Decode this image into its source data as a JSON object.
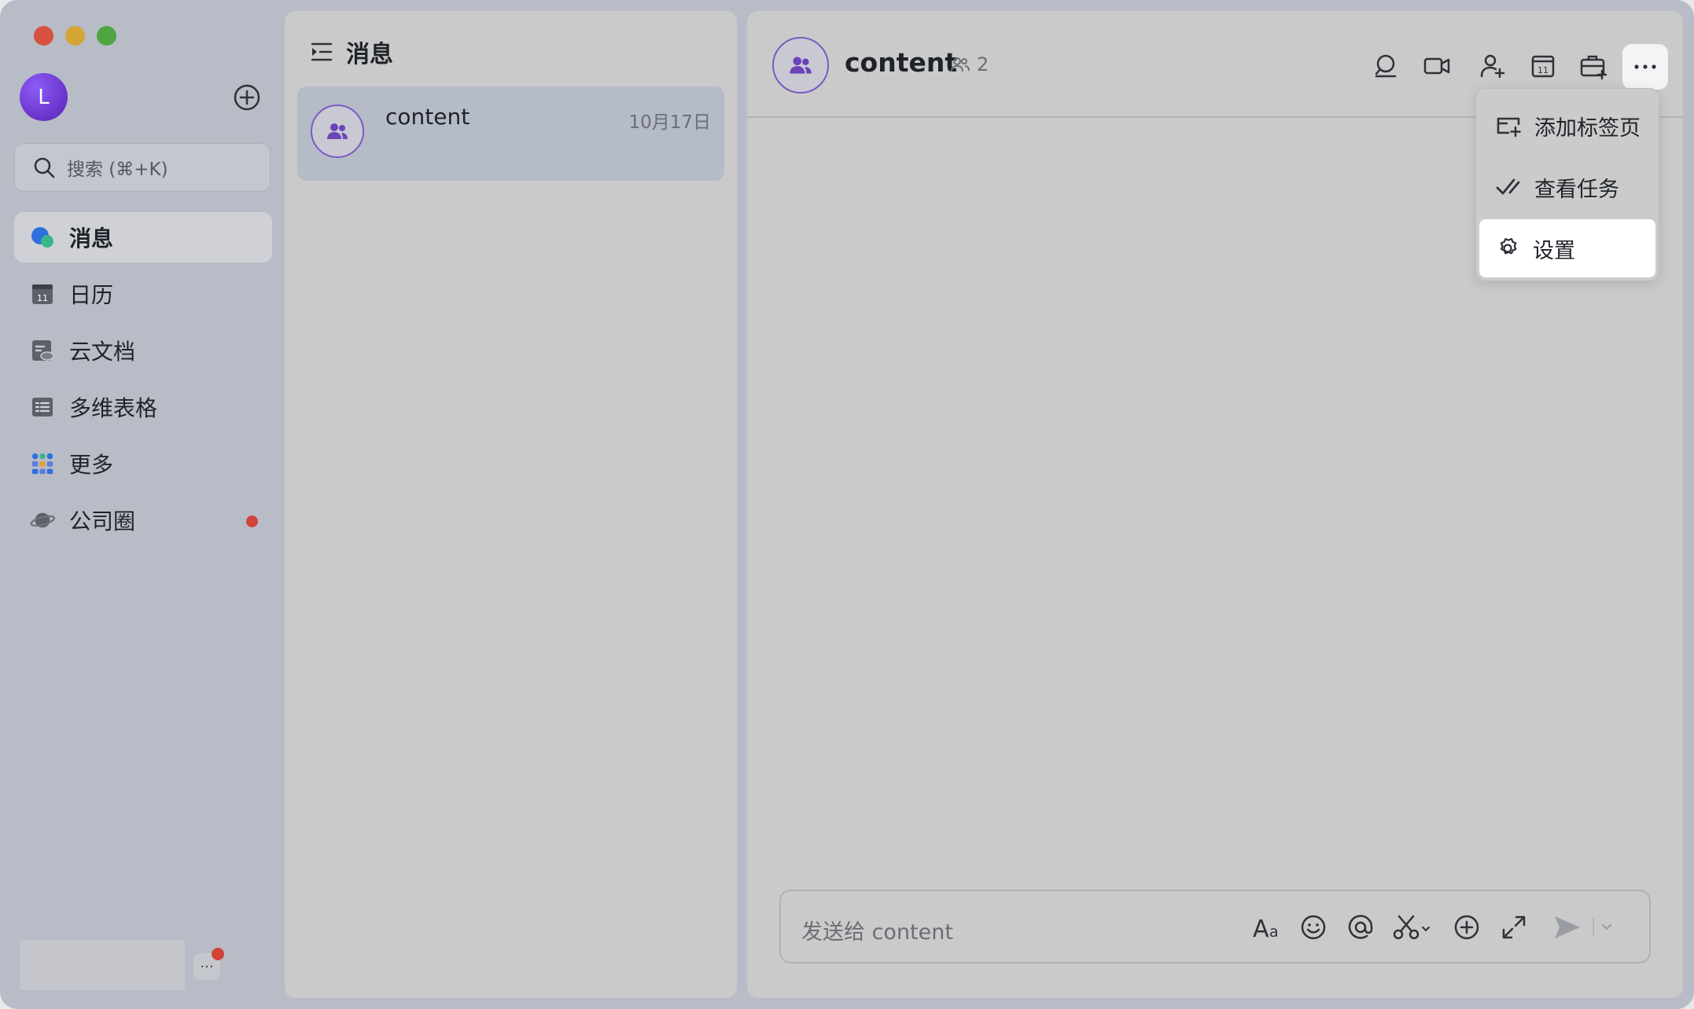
{
  "sidebar": {
    "avatar_initial": "L",
    "search": {
      "placeholder": "搜索 (⌘+K)"
    },
    "items": [
      {
        "label": "消息",
        "icon": "chat-bubble-icon",
        "active": true
      },
      {
        "label": "日历",
        "icon": "calendar-icon"
      },
      {
        "label": "云文档",
        "icon": "cloud-doc-icon"
      },
      {
        "label": "多维表格",
        "icon": "table-icon"
      },
      {
        "label": "更多",
        "icon": "apps-grid-icon"
      },
      {
        "label": "公司圈",
        "icon": "planet-icon",
        "badge": true
      }
    ],
    "more_label": "···"
  },
  "list": {
    "title": "消息",
    "conversations": [
      {
        "name": "content",
        "date": "10月17日"
      }
    ]
  },
  "chat": {
    "title": "content",
    "member_count": "2",
    "toolbar_icons": [
      "search-icon",
      "video-icon",
      "add-member-icon",
      "calendar-icon",
      "briefcase-icon",
      "more-icon"
    ],
    "menu": [
      {
        "label": "添加标签页",
        "icon": "add-tab-icon"
      },
      {
        "label": "查看任务",
        "icon": "task-check-icon"
      },
      {
        "label": "设置",
        "icon": "gear-icon",
        "highlighted": true
      }
    ],
    "composer": {
      "placeholder": "发送给 content"
    }
  },
  "colors": {
    "accent": "#7b5ac2",
    "badge": "#d0443a",
    "menu_highlight": "#ffffff"
  }
}
